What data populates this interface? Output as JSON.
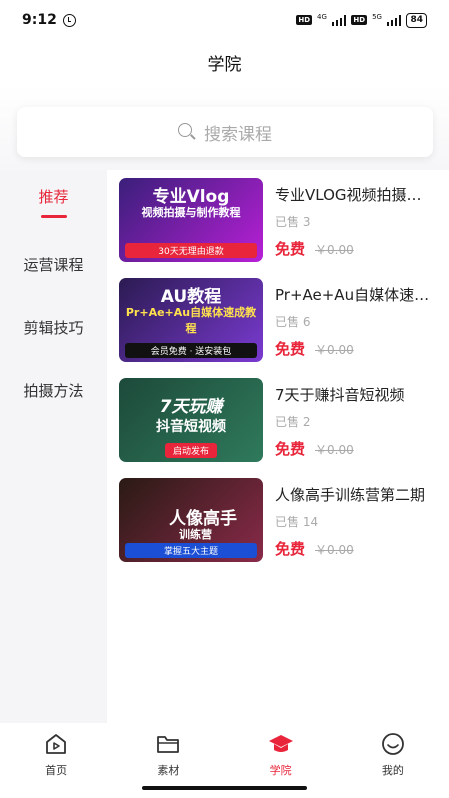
{
  "status": {
    "time": "9:12",
    "net1": "4G",
    "net2": "5G",
    "hd": "HD",
    "battery": "84"
  },
  "header": {
    "title": "学院"
  },
  "search": {
    "placeholder": "搜索课程"
  },
  "sidebar": {
    "items": [
      {
        "label": "推荐",
        "active": true
      },
      {
        "label": "运营课程"
      },
      {
        "label": "剪辑技巧"
      },
      {
        "label": "拍摄方法"
      }
    ]
  },
  "courses": [
    {
      "title": "专业VLOG视频拍摄与制作教程",
      "sold": "已售 3",
      "price": "免费",
      "original_price": "￥0.00",
      "thumb": {
        "line1": "专业Vlog",
        "line2": "视频拍摄与制作教程",
        "line3": "30天无理由退款",
        "bg": "#3a1f7a",
        "accent": "#b81fd6"
      }
    },
    {
      "title": "Pr+Ae+Au自媒体速成教程",
      "sold": "已售 6",
      "price": "免费",
      "original_price": "￥0.00",
      "thumb": {
        "line1": "AU教程",
        "line2": "Pr+Ae+Au自媒体速成教程",
        "line3": "会员免费 · 送安装包",
        "bg": "#2b1b52",
        "accent": "#7a3ad1"
      }
    },
    {
      "title": "7天于赚抖音短视频",
      "sold": "已售 2",
      "price": "免费",
      "original_price": "￥0.00",
      "thumb": {
        "line1": "7天玩赚",
        "line2": "抖音短视频",
        "line3": "启动发布",
        "bg": "#1d4a3a",
        "accent": "#2f7a5c"
      }
    },
    {
      "title": "人像高手训练营第二期",
      "sold": "已售 14",
      "price": "免费",
      "original_price": "￥0.00",
      "thumb": {
        "line1": "人像高手",
        "line2": "训练营",
        "line3": "掌握五大主题",
        "bg": "#2a1a14",
        "accent": "#8a2a4a"
      }
    }
  ],
  "tabbar": {
    "items": [
      {
        "label": "首页"
      },
      {
        "label": "素材"
      },
      {
        "label": "学院",
        "active": true
      },
      {
        "label": "我的"
      }
    ]
  },
  "colors": {
    "accent": "#e8253a",
    "muted": "#aaaaaa"
  }
}
